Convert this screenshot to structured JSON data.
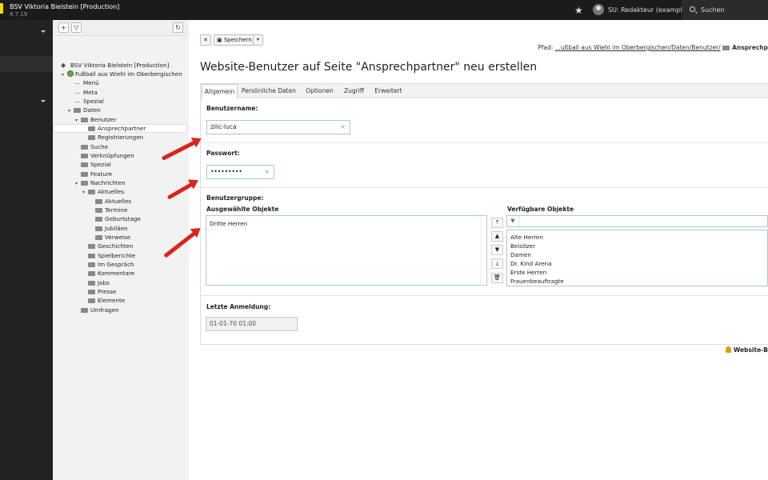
{
  "app": {
    "site_name": "BSV Viktoria Bielstein [Production]",
    "version": "8.7.19"
  },
  "topbar": {
    "user": "SU: Redakteur (example)",
    "search": "Suchen"
  },
  "tree": {
    "root": "BSV Viktoria Bielstein [Production]",
    "site": "Fußball aus Wiehl im Oberbergischen",
    "nodes": [
      "Menü",
      "Meta",
      "Spezial",
      "Daten",
      "Benutzer",
      "Ansprechpartner",
      "Registrierungen",
      "Suche",
      "Verknüpfungen",
      "Spezial",
      "Feature",
      "Nachrichten",
      "Aktuelles",
      "Aktuelles",
      "Termine",
      "Geburtstage",
      "Jubiläen",
      "Verweise",
      "Geschichten",
      "Spielberichte",
      "Im Gespräch",
      "Kommentare",
      "Jobs",
      "Presse",
      "Elemente",
      "Umfragen"
    ]
  },
  "header": {
    "save": "Speichern",
    "path_prefix": "Pfad:",
    "path_link": "...ußball aus Wiehl im Oberbergischen/Daten/Benutzer/",
    "path_current": "Ansprechp"
  },
  "page": {
    "title": "Website-Benutzer auf Seite \"Ansprechpartner\" neu erstellen"
  },
  "tabs": [
    "Allgemein",
    "Persönliche Daten",
    "Optionen",
    "Zugriff",
    "Erweitert"
  ],
  "form": {
    "username_label": "Benutzername:",
    "username_value": "zilic-luca",
    "password_label": "Passwort:",
    "password_value": "•••••••••",
    "group_label": "Benutzergruppe:",
    "selected_label": "Ausgewählte Objekte",
    "available_label": "Verfügbare Objekte",
    "selected_items": [
      "Dritte Herren"
    ],
    "available_items": [
      "Alte Herren",
      "Beisitzer",
      "Damen",
      "Dr. Kind Arena",
      "Erste Herren",
      "Frauenbeauftragte"
    ],
    "last_login_label": "Letzte Anmeldung:",
    "last_login_value": "01-01-70 01:00"
  },
  "footer": {
    "label": "Website-B"
  }
}
